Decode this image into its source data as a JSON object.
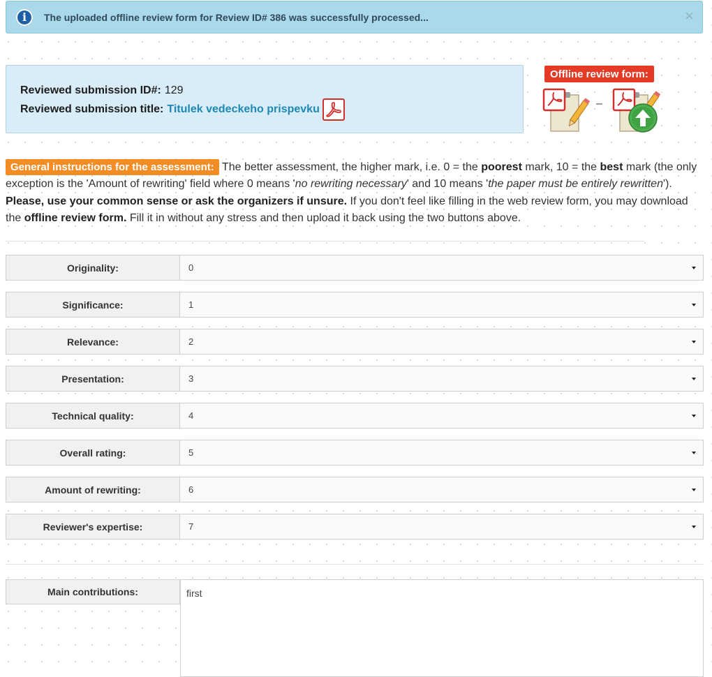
{
  "alert": {
    "message": "The uploaded offline review form for Review ID# 386 was successfully processed...",
    "close_symbol": "×",
    "info_symbol": "i",
    "color": "#a9d9ea"
  },
  "submission": {
    "id_label": "Reviewed submission ID#:",
    "id_value": "129",
    "title_label": "Reviewed submission title:",
    "title_value": "Titulek vedeckeho prispevku",
    "link_color": "#1e88b5"
  },
  "offline_form": {
    "label": "Offline review form:",
    "separator": "–",
    "label_color": "#e53a25"
  },
  "instructions": {
    "badge": "General instructions for the assessment:",
    "badge_color": "#f28c25",
    "t1": " The better assessment, the higher mark, i.e. 0 = the ",
    "b1": "poorest",
    "t2": " mark, 10 = the ",
    "b2": "best",
    "t3": " mark (the only exception is the 'Amount of rewriting' field where 0 means '",
    "i1": "no rewriting necessary",
    "t4": "' and 10 means '",
    "i2": "the paper must be entirely rewritten",
    "t5": "'). ",
    "b3": "Please, use your common sense or ask the organizers if unsure.",
    "t6": " If you don't feel like filling in the web review form, you may download the ",
    "b4": "offline review form.",
    "t7": " Fill it in without any stress and then upload it back using the two buttons above."
  },
  "ratings": [
    {
      "label": "Originality:",
      "value": "0"
    },
    {
      "label": "Significance:",
      "value": "1"
    },
    {
      "label": "Relevance:",
      "value": "2"
    },
    {
      "label": "Presentation:",
      "value": "3"
    },
    {
      "label": "Technical quality:",
      "value": "4"
    },
    {
      "label": "Overall rating:",
      "value": "5"
    },
    {
      "label": "Amount of rewriting:",
      "value": "6"
    },
    {
      "label": "Reviewer's expertise:",
      "value": "7"
    }
  ],
  "contributions": {
    "label": "Main contributions:",
    "value": "first"
  },
  "icons": {
    "info": "info-circle-icon",
    "close": "close-icon",
    "pdf": "pdf-icon",
    "download_form": "pdf-edit-download-icon",
    "upload_form": "pdf-upload-icon",
    "dropdown": "caret-down-icon"
  }
}
